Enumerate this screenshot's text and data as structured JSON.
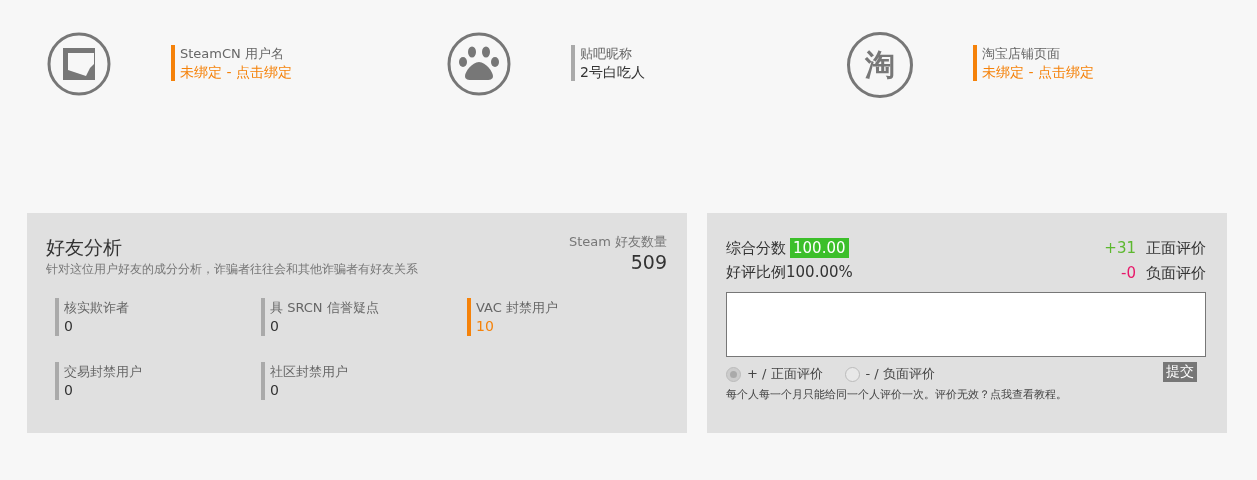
{
  "accounts": [
    {
      "kind": "square",
      "label": "SteamCN 用户名",
      "value": "未绑定 - 点击绑定",
      "bound": false
    },
    {
      "kind": "paw",
      "label": "贴吧昵称",
      "value": "2号白吃人",
      "bound": true
    },
    {
      "kind": "glyph",
      "glyph": "淘",
      "label": "淘宝店铺页面",
      "value": "未绑定 - 点击绑定",
      "bound": false
    }
  ],
  "friends": {
    "title": "好友分析",
    "subtitle": "针对这位用户好友的成分分析，诈骗者往往会和其他诈骗者有好友关系",
    "count_label": "Steam 好友数量",
    "count": "509",
    "stats": [
      {
        "label": "核实欺诈者",
        "value": "0",
        "flagged": false
      },
      {
        "label": "具 SRCN 信誉疑点",
        "value": "0",
        "flagged": false
      },
      {
        "label": "VAC 封禁用户",
        "value": "10",
        "flagged": true
      },
      {
        "label": "交易封禁用户",
        "value": "0",
        "flagged": false
      },
      {
        "label": "社区封禁用户",
        "value": "0",
        "flagged": false
      }
    ]
  },
  "rating": {
    "score_label": "综合分数",
    "score": "100.00",
    "ratio": "好评比例100.00%",
    "positive_count": "+31",
    "positive_label": "正面评价",
    "negative_count": "-0",
    "negative_label": "负面评价",
    "options": [
      {
        "label": "+ / 正面评价",
        "selected": true
      },
      {
        "label": "- / 负面评价",
        "selected": false
      }
    ],
    "submit": "提交",
    "note": "每个人每一个月只能给同一个人评价一次。评价无效？点我查看教程。"
  }
}
